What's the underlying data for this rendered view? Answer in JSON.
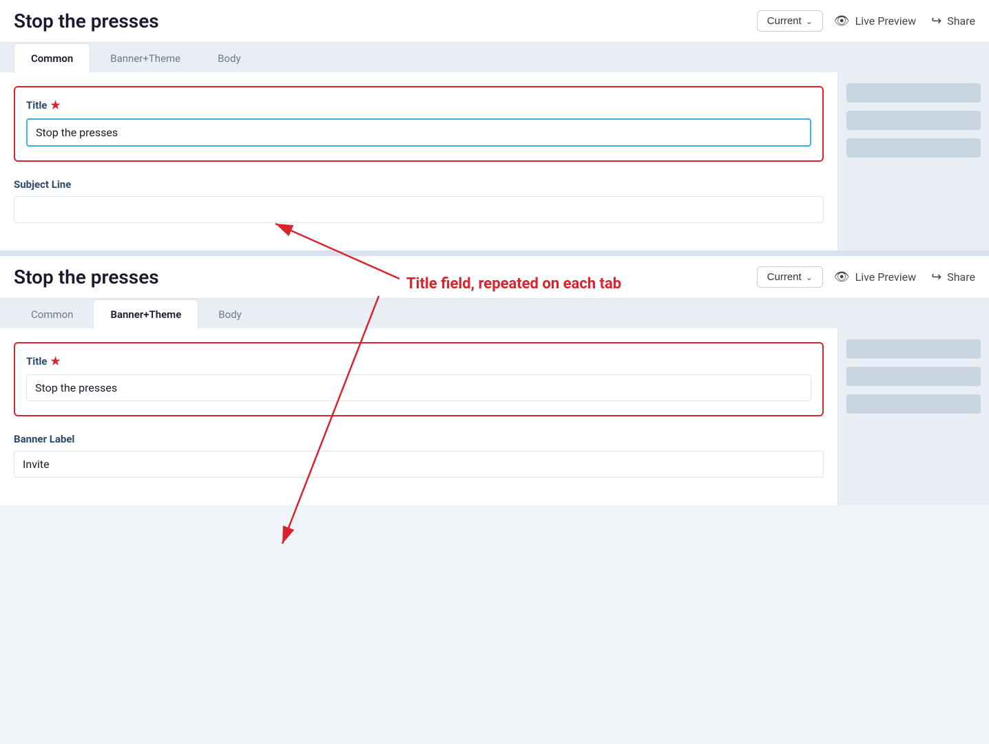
{
  "page": {
    "title": "Stop the presses"
  },
  "panel1": {
    "title": "Stop the presses",
    "version_label": "Current",
    "live_preview_label": "Live Preview",
    "share_label": "Share",
    "tabs": [
      {
        "id": "common",
        "label": "Common",
        "active": true
      },
      {
        "id": "banner-theme",
        "label": "Banner+Theme",
        "active": false
      },
      {
        "id": "body",
        "label": "Body",
        "active": false
      }
    ],
    "title_field": {
      "label": "Title",
      "required": true,
      "value": "Stop the presses",
      "focused": true
    },
    "subject_line_field": {
      "label": "Subject Line",
      "required": false,
      "value": ""
    }
  },
  "panel2": {
    "title": "Stop the presses",
    "version_label": "Current",
    "live_preview_label": "Live Preview",
    "share_label": "Share",
    "tabs": [
      {
        "id": "common",
        "label": "Common",
        "active": false
      },
      {
        "id": "banner-theme",
        "label": "Banner+Theme",
        "active": true
      },
      {
        "id": "body",
        "label": "Body",
        "active": false
      }
    ],
    "title_field": {
      "label": "Title",
      "required": true,
      "value": "Stop the presses"
    },
    "banner_label_field": {
      "label": "Banner Label",
      "value": "Invite"
    }
  },
  "annotation": {
    "text": "Title field, repeated on each tab",
    "arrow_color": "#d9232d"
  }
}
